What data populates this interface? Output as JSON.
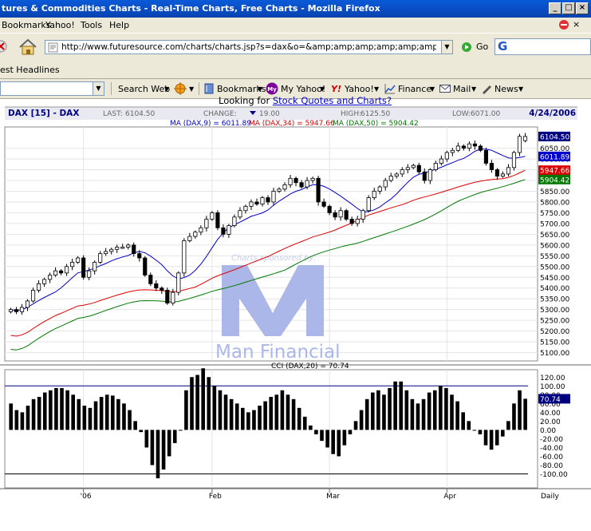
{
  "window": {
    "title": "tures & Commodities Charts - Real-Time Charts, Free Charts - Mozilla Firefox"
  },
  "menu": {
    "items": [
      "Bookmarks",
      "Yahoo!",
      "Tools",
      "Help"
    ]
  },
  "nav": {
    "url": "http://www.futuresource.com/charts/charts.jsp?s=dax&o=&amp;amp;amp;amp;amp;amp;amp;amp;amp;amp;a=i",
    "go": "Go"
  },
  "bookmarks": {
    "headlines": "est Headlines"
  },
  "yahoo_toolbar": {
    "search_web": "Search Web",
    "bookmarks": "Bookmarks",
    "my_yahoo": "My Yahoo!",
    "yahoo": "Yahoo!",
    "finance": "Finance",
    "mail": "Mail",
    "news": "News"
  },
  "page": {
    "promo_prefix": "Looking for ",
    "promo_link": "Stock Quotes and Charts?"
  },
  "chart_header": {
    "symbol": "DAX [15] - DAX",
    "last_label": "LAST:",
    "last": "6104.50",
    "change_label": "CHANGE:",
    "change": "19.00",
    "high_label": "HIGH:",
    "high": "6125.50",
    "low_label": "LOW:",
    "low": "6071.00",
    "date": "4/24/2006"
  },
  "ma_legend": {
    "ma9": "MA (DAX,9) = 6011.89",
    "ma34": "MA (DAX,34) = 5947.66",
    "ma50": "MA (DAX,50) = 5904.42"
  },
  "cci_legend": "CCI (DAX,20) = 70.74",
  "watermark": {
    "sponsor": "Charts sponsored by:",
    "brand": "Man Financial"
  },
  "colors": {
    "ma9": "#0000cc",
    "ma34": "#dd0000",
    "ma50": "#007700",
    "last_box": "#000080",
    "watermark": "#a8b4e8"
  },
  "chart_data": [
    {
      "type": "candlestick",
      "title": "DAX [15] - DAX",
      "y_ticks": [
        "6050.00",
        "6000.00",
        "5950.00",
        "5900.00",
        "5850.00",
        "5800.00",
        "5750.00",
        "5700.00",
        "5650.00",
        "5600.00",
        "5550.00",
        "5500.00",
        "5450.00",
        "5400.00",
        "5350.00",
        "5300.00",
        "5250.00",
        "5200.00",
        "5150.00",
        "5100.00"
      ],
      "ylim": [
        5065,
        6145
      ],
      "x_labels": [
        "'06",
        "Feb",
        "Mar",
        "Apr"
      ],
      "x_label_index": [
        13,
        36,
        57,
        78
      ],
      "period": "Daily",
      "value_boxes": [
        {
          "text": "6104.50",
          "value": 6104.5,
          "color": "#000080"
        },
        {
          "text": "6011.89",
          "value": 6011.89,
          "color": "#0000cc"
        },
        {
          "text": "5947.66",
          "value": 5947.66,
          "color": "#dd0000"
        },
        {
          "text": "5904.42",
          "value": 5904.42,
          "color": "#007700"
        }
      ],
      "close": [
        5300,
        5290,
        5310,
        5340,
        5390,
        5420,
        5440,
        5460,
        5480,
        5470,
        5500,
        5520,
        5540,
        5450,
        5480,
        5520,
        5560,
        5570,
        5580,
        5590,
        5590,
        5600,
        5560,
        5540,
        5460,
        5420,
        5400,
        5390,
        5330,
        5380,
        5470,
        5620,
        5640,
        5660,
        5680,
        5720,
        5750,
        5680,
        5650,
        5690,
        5730,
        5760,
        5780,
        5800,
        5790,
        5820,
        5800,
        5850,
        5860,
        5880,
        5910,
        5890,
        5870,
        5900,
        5910,
        5800,
        5780,
        5750,
        5730,
        5760,
        5720,
        5700,
        5720,
        5760,
        5820,
        5850,
        5870,
        5900,
        5920,
        5930,
        5950,
        5960,
        5970,
        5940,
        5900,
        5950,
        5980,
        6000,
        6030,
        6040,
        6060,
        6050,
        6070,
        6060,
        6040,
        5980,
        5950,
        5920,
        5930,
        5960,
        6030,
        6105,
        6104.5
      ],
      "open": [
        5290,
        5300,
        5290,
        5310,
        5340,
        5390,
        5420,
        5440,
        5460,
        5480,
        5470,
        5500,
        5520,
        5540,
        5450,
        5480,
        5520,
        5560,
        5570,
        5580,
        5590,
        5590,
        5600,
        5560,
        5540,
        5460,
        5420,
        5400,
        5390,
        5330,
        5380,
        5470,
        5620,
        5640,
        5660,
        5680,
        5720,
        5750,
        5680,
        5650,
        5690,
        5730,
        5760,
        5780,
        5800,
        5790,
        5820,
        5800,
        5850,
        5860,
        5880,
        5910,
        5890,
        5870,
        5900,
        5910,
        5800,
        5780,
        5750,
        5730,
        5760,
        5720,
        5700,
        5720,
        5760,
        5820,
        5850,
        5870,
        5900,
        5920,
        5930,
        5950,
        5960,
        5970,
        5940,
        5900,
        5950,
        5980,
        6000,
        6030,
        6040,
        6060,
        6050,
        6070,
        6060,
        6040,
        5980,
        5950,
        5920,
        5930,
        5960,
        6030,
        6085
      ],
      "series": [
        {
          "name": "MA (DAX,9)",
          "last": 6011.89
        },
        {
          "name": "MA (DAX,34)",
          "last": 5947.66
        },
        {
          "name": "MA (DAX,50)",
          "last": 5904.42
        }
      ]
    },
    {
      "type": "bar",
      "title": "CCI (DAX,20) = 70.74",
      "y_ticks": [
        "120.00",
        "100.00",
        "80.00",
        "60.00",
        "40.00",
        "20.00",
        "0.00",
        "-20.00",
        "-40.00",
        "-60.00",
        "-80.00",
        "-100.00"
      ],
      "ylim": [
        -130,
        135
      ],
      "reference_lines": [
        100,
        -100
      ],
      "value_box": {
        "text": "70.74",
        "value": 70.74
      },
      "values": [
        60,
        45,
        40,
        55,
        70,
        75,
        85,
        90,
        95,
        95,
        90,
        80,
        70,
        55,
        50,
        65,
        75,
        80,
        78,
        70,
        60,
        45,
        20,
        -5,
        -40,
        -80,
        -110,
        -90,
        -60,
        -30,
        0,
        90,
        120,
        125,
        140,
        120,
        100,
        90,
        80,
        70,
        60,
        50,
        40,
        45,
        55,
        65,
        75,
        80,
        90,
        80,
        70,
        50,
        30,
        10,
        -10,
        -25,
        -40,
        -55,
        -60,
        -35,
        -10,
        20,
        45,
        70,
        85,
        90,
        80,
        95,
        110,
        110,
        90,
        70,
        60,
        70,
        85,
        90,
        100,
        95,
        80,
        65,
        40,
        20,
        0,
        -10,
        -35,
        -45,
        -35,
        -15,
        20,
        60,
        90,
        70.74
      ]
    }
  ]
}
